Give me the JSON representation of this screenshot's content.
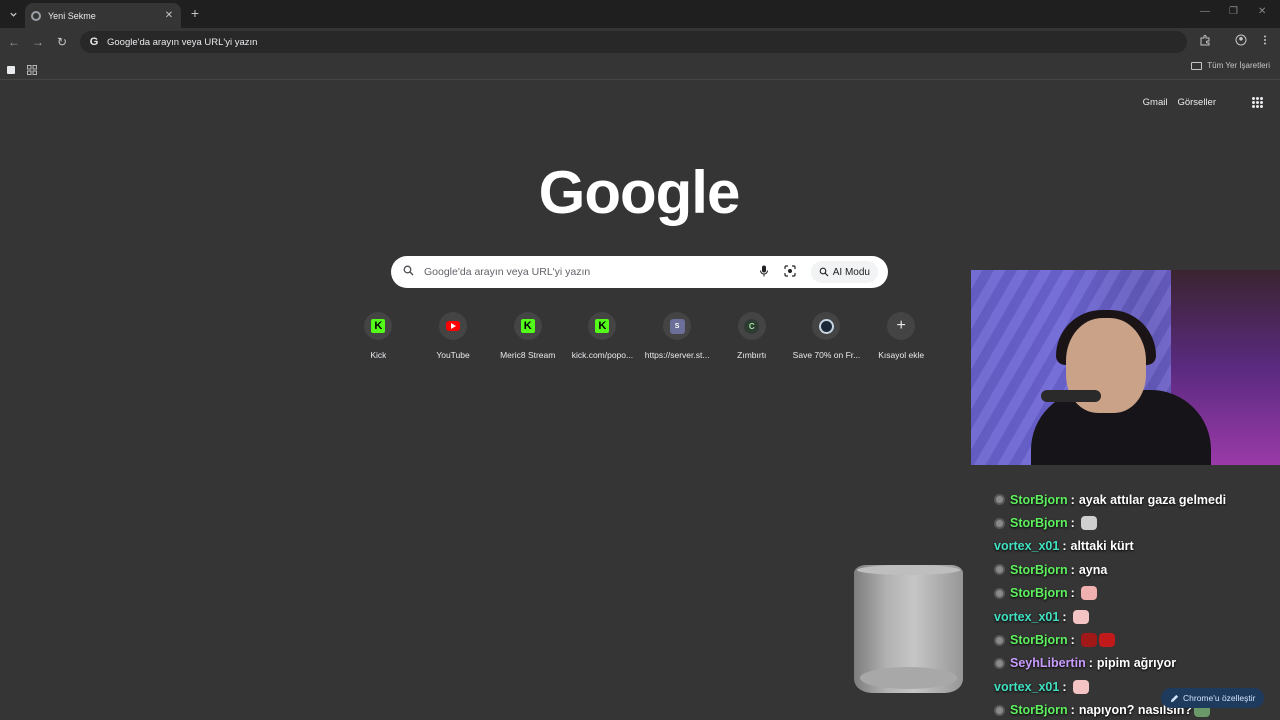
{
  "tab": {
    "title": "Yeni Sekme",
    "close": "✕",
    "new": "+"
  },
  "window": {
    "minimize": "—",
    "maximize": "❐",
    "close": "✕"
  },
  "toolbar": {
    "back": "←",
    "forward": "→",
    "reload": "↻",
    "omnibox_text": "Google'da arayın veya URL'yi yazın"
  },
  "bookmarks": {
    "all_label": "Tüm Yer İşaretleri"
  },
  "ntp": {
    "gmail": "Gmail",
    "images": "Görseller",
    "logo": "Google",
    "search_placeholder": "Google'da arayın veya URL'yi yazın",
    "ai_mode": "AI Modu",
    "shortcuts": [
      {
        "label": "Kick",
        "icon": "kick-icon"
      },
      {
        "label": "YouTube",
        "icon": "youtube-icon"
      },
      {
        "label": "Meric8 Stream",
        "icon": "kick-icon"
      },
      {
        "label": "kick.com/popo...",
        "icon": "kick-icon"
      },
      {
        "label": "https://server.st...",
        "icon": "server-icon"
      },
      {
        "label": "Zımbırtı",
        "icon": "zimbirti-icon"
      },
      {
        "label": "Save 70% on Fr...",
        "icon": "steam-icon"
      },
      {
        "label": "Kısayol ekle",
        "icon": "plus-icon"
      }
    ],
    "customize": "Chrome'u özelleştir"
  },
  "chat": {
    "colors": {
      "StorBjorn": "#5ef05e",
      "vortex_x01": "#40e0c0",
      "SeyhLibertin": "#c89cff"
    },
    "messages": [
      {
        "user": "StorBjorn",
        "badge": true,
        "text": "ayak attılar gaza gelmedi",
        "emotes": []
      },
      {
        "user": "StorBjorn",
        "badge": true,
        "text": "",
        "emotes": [
          "#cfcfcf"
        ]
      },
      {
        "user": "vortex_x01",
        "badge": false,
        "text": "alttaki kürt",
        "emotes": []
      },
      {
        "user": "StorBjorn",
        "badge": true,
        "text": "ayna",
        "emotes": []
      },
      {
        "user": "StorBjorn",
        "badge": true,
        "text": "",
        "emotes": [
          "#f0b0b0"
        ]
      },
      {
        "user": "vortex_x01",
        "badge": false,
        "text": "",
        "emotes": [
          "#f4c4c4"
        ]
      },
      {
        "user": "StorBjorn",
        "badge": true,
        "text": "",
        "emotes": [
          "#a01818",
          "#c01a1a"
        ]
      },
      {
        "user": "SeyhLibertin",
        "badge": true,
        "text": "pipim ağrıyor",
        "emotes": []
      },
      {
        "user": "vortex_x01",
        "badge": false,
        "text": "",
        "emotes": [
          "#f4c4c4"
        ]
      },
      {
        "user": "StorBjorn",
        "badge": true,
        "text": "napıyon? nasılsın?",
        "emotes": [
          "#6a9a6a"
        ]
      }
    ]
  }
}
